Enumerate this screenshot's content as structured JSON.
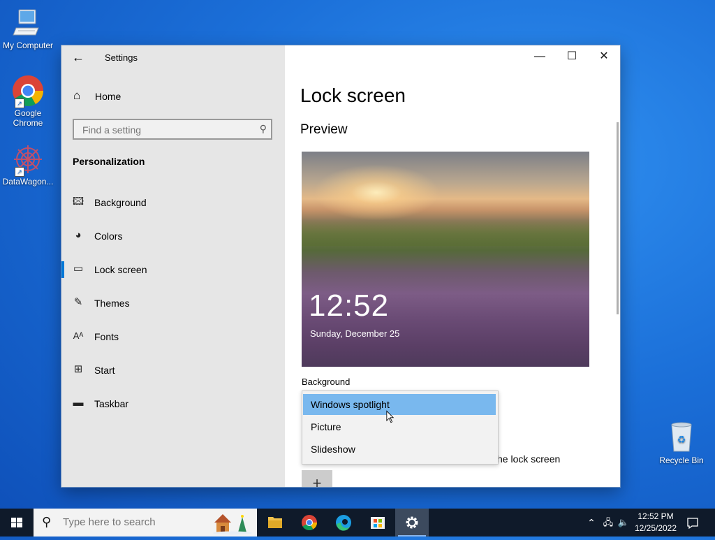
{
  "desktop": {
    "icons": [
      {
        "label": "My Computer"
      },
      {
        "label": "Google Chrome"
      },
      {
        "label": "DataWagon..."
      }
    ],
    "recycle_bin": "Recycle Bin"
  },
  "window": {
    "app_title": "Settings",
    "back_icon": "back-arrow-icon",
    "controls": {
      "minimize": "—",
      "maximize": "☐",
      "close": "✕"
    }
  },
  "nav": {
    "home": "Home",
    "search_placeholder": "Find a setting",
    "section": "Personalization",
    "items": [
      {
        "label": "Background",
        "icon": "picture-icon"
      },
      {
        "label": "Colors",
        "icon": "palette-icon"
      },
      {
        "label": "Lock screen",
        "icon": "lock-screen-icon",
        "active": true
      },
      {
        "label": "Themes",
        "icon": "themes-icon"
      },
      {
        "label": "Fonts",
        "icon": "fonts-icon"
      },
      {
        "label": "Start",
        "icon": "start-icon"
      },
      {
        "label": "Taskbar",
        "icon": "taskbar-icon"
      }
    ]
  },
  "content": {
    "title": "Lock screen",
    "preview_heading": "Preview",
    "preview_time": "12:52",
    "preview_date": "Sunday, December 25",
    "background_label": "Background",
    "dropdown_options": [
      "Windows spotlight",
      "Picture",
      "Slideshow"
    ],
    "selected_option": "Windows spotlight",
    "partial_text": "he lock screen",
    "add_symbol": "+"
  },
  "taskbar": {
    "search_placeholder": "Type here to search",
    "clock_time": "12:52 PM",
    "clock_date": "12/25/2022"
  },
  "colors": {
    "accent": "#0078d7",
    "selected_option": "#79b8ee",
    "taskbar": "#0f1a2a"
  }
}
